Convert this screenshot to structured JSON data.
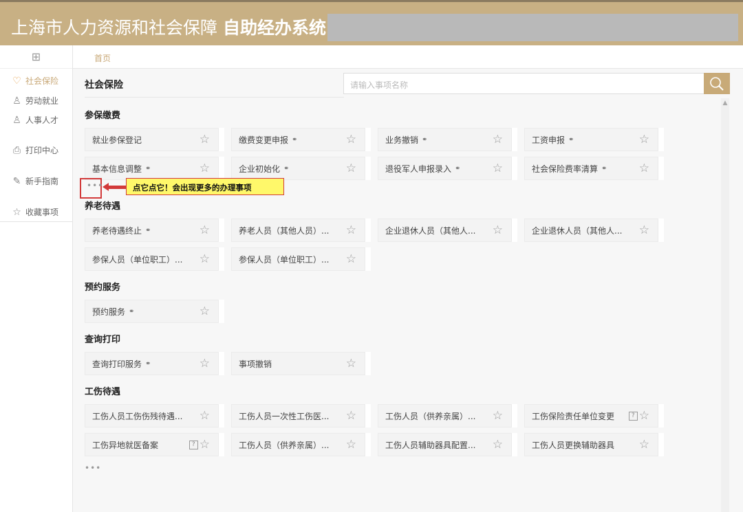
{
  "header": {
    "title_normal": "上海市人力资源和社会保障",
    "title_bold": "自助经办系统"
  },
  "sidebar": {
    "items": [
      {
        "label": "社会保险",
        "icon": "shield-heart-icon",
        "glyph": "♡",
        "active": true
      },
      {
        "label": "劳动就业",
        "icon": "worker-icon",
        "glyph": "♙"
      },
      {
        "label": "人事人才",
        "icon": "people-icon",
        "glyph": "♙"
      },
      {
        "label": "打印中心",
        "icon": "printer-icon",
        "glyph": "⎙"
      },
      {
        "label": "新手指南",
        "icon": "guide-icon",
        "glyph": "✎"
      },
      {
        "label": "收藏事项",
        "icon": "star-icon",
        "glyph": "☆"
      }
    ]
  },
  "breadcrumb": "首页",
  "main_title": "社会保险",
  "search": {
    "placeholder": "请输入事项名称"
  },
  "annotation": "点它点它！会出现更多的办理事项",
  "more_label": "•••",
  "colors": {
    "brand": "#c8b084",
    "accent": "#c9a978",
    "highlight": "#d23a3a",
    "note_bg": "#fff86a"
  },
  "sections": [
    {
      "title": "参保缴费",
      "show_more": true,
      "items": [
        {
          "label": "就业参保登记"
        },
        {
          "label": "缴费变更申报",
          "link": true
        },
        {
          "label": "业务撤销",
          "link": true
        },
        {
          "label": "工资申报",
          "link": true
        },
        {
          "label": "基本信息调整",
          "link": true
        },
        {
          "label": "企业初始化",
          "link": true
        },
        {
          "label": "退役军人申报录入",
          "link": true
        },
        {
          "label": "社会保险费率清算",
          "link": true
        }
      ]
    },
    {
      "title": "养老待遇",
      "items": [
        {
          "label": "养老待遇终止",
          "link": true
        },
        {
          "label": "养老人员（其他人员）..."
        },
        {
          "label": "企业退休人员（其他人..."
        },
        {
          "label": "企业退休人员（其他人..."
        },
        {
          "label": "参保人员（单位职工）..."
        },
        {
          "label": "参保人员（单位职工）..."
        }
      ]
    },
    {
      "title": "预约服务",
      "items": [
        {
          "label": "预约服务",
          "link": true
        }
      ]
    },
    {
      "title": "查询打印",
      "items": [
        {
          "label": "查询打印服务",
          "link": true
        },
        {
          "label": "事项撤销"
        }
      ]
    },
    {
      "title": "工伤待遇",
      "show_more_bottom": true,
      "items": [
        {
          "label": "工伤人员工伤伤残待遇..."
        },
        {
          "label": "工伤人员一次性工伤医..."
        },
        {
          "label": "工伤人员（供养亲属）..."
        },
        {
          "label": "工伤保险责任单位变更",
          "help": true
        },
        {
          "label": "工伤异地就医备案",
          "help": true
        },
        {
          "label": "工伤人员（供养亲属）..."
        },
        {
          "label": "工伤人员辅助器具配置..."
        },
        {
          "label": "工伤人员更换辅助器具"
        }
      ]
    }
  ]
}
